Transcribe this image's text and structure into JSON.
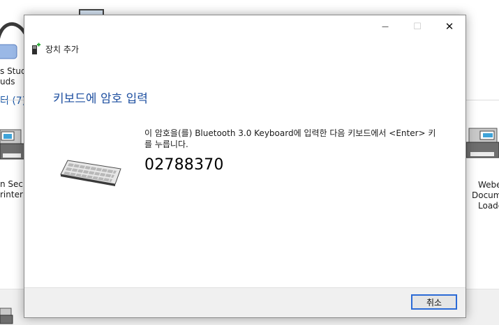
{
  "background": {
    "labels": {
      "device1_line1": "s Studi",
      "device1_line2": "uds",
      "section_count": "터 (7)",
      "device2_line1": "n Secu",
      "device2_line2": "rinter",
      "device3_line1": "Webe",
      "device3_line2": "Docum",
      "device3_line3": "Loade"
    }
  },
  "dialog": {
    "title": "장치 추가",
    "heading": "키보드에 암호 입력",
    "instruction": "이 암호을(를) Bluetooth 3.0 Keyboard에 입력한 다음 키보드에서 <Enter> 키를 누릅니다.",
    "pin": "02788370",
    "cancel_label": "취소",
    "window_controls": {
      "minimize": "—",
      "maximize": "☐",
      "close": "✕"
    },
    "icons": {
      "title_icon": "add-device-icon",
      "illustration": "keyboard-icon"
    }
  },
  "colors": {
    "accent": "#1e4fa0",
    "button_border": "#2b6ad6",
    "footer": "#f0f0f0"
  }
}
